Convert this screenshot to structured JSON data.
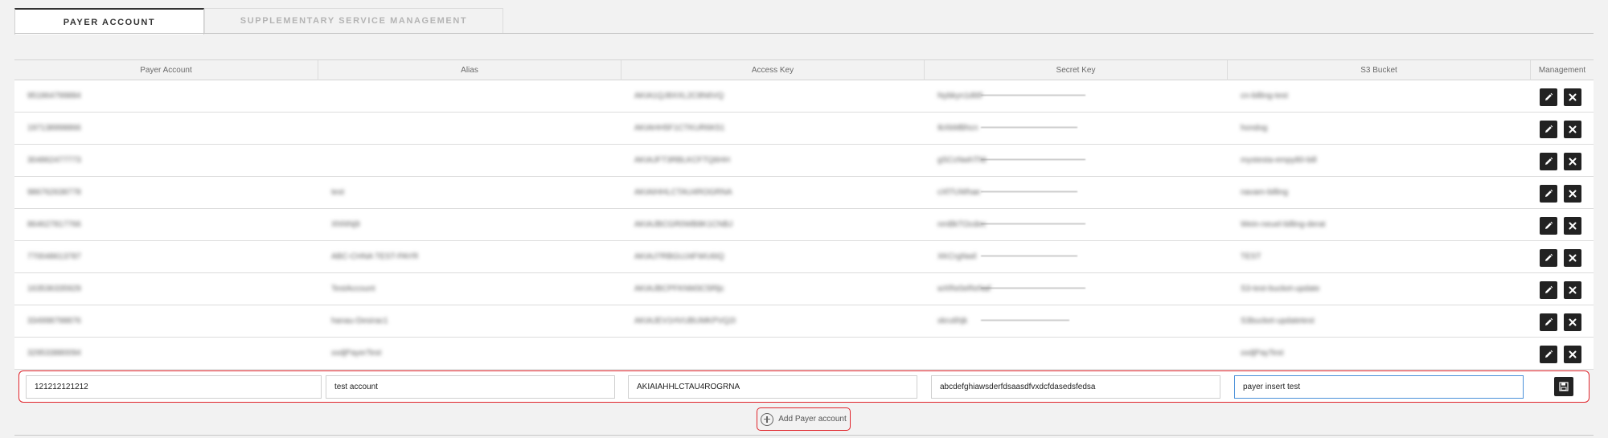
{
  "tabs": [
    {
      "label": "PAYER ACCOUNT",
      "active": true
    },
    {
      "label": "SUPPLEMENTARY SERVICE MANAGEMENT",
      "active": false
    }
  ],
  "table": {
    "headers": [
      "Payer Account",
      "Alias",
      "Access Key",
      "Secret Key",
      "S3 Bucket",
      "Management"
    ],
    "rows": [
      {
        "payer": "951864799884",
        "alias": "",
        "access_key": "AKIA1QJ8XXL2C8N6VQ",
        "secret_key": "Nybkyn1d6tf",
        "bucket": "cn-billing-test"
      },
      {
        "payer": "197138998866",
        "alias": "",
        "access_key": "AKIAHH5F1CTKUR6K51",
        "secret_key": "IkXkMBhcn",
        "bucket": "hondog"
      },
      {
        "payer": "304862477773",
        "alias": "",
        "access_key": "AKIAJFT3RBLKCFTQ6HH",
        "secret_key": "gSCcNwhTNt",
        "bucket": "mystesta-empy80-bill"
      },
      {
        "payer": "986762638778",
        "alias": "test",
        "access_key": "AKIAIHHLCTAU4ROGRNA",
        "secret_key": "cXf7UWhae",
        "bucket": "navam-billing"
      },
      {
        "payer": "864627817766",
        "alias": "Xhf4Nj9",
        "access_key": "AKIAJBCGR0WB8K1CNBJ",
        "secret_key": "nmBkTOcdec",
        "bucket": "Wein-neuel-billing-derat"
      },
      {
        "payer": "770048613787",
        "alias": "ABC-CHNA TEST-PAYR",
        "access_key": "AKIAJ7RBGUJ4FWU6IQ",
        "secret_key": "XKCrgNwil",
        "bucket": "TEST"
      },
      {
        "payer": "163536335929",
        "alias": "TestAccount",
        "access_key": "AKIAJBCPFKNM3C5Rljc",
        "secret_key": "wXRe0eReNaf",
        "bucket": "S3-test-bucket-update"
      },
      {
        "payer": "334998798876",
        "alias": "hanau-Desirac1",
        "access_key": "AKIAJEV1HVUBUMKPVQ2I",
        "secret_key": "xkru6hjk",
        "bucket": "S3bucket-updatetest"
      },
      {
        "payer": "329533880094",
        "alias": "xxdjPayerTest",
        "access_key": "",
        "secret_key": "",
        "bucket": "xxdjPayTest"
      }
    ]
  },
  "insert_row": {
    "payer": "121212121212",
    "alias": "test account",
    "access_key": "AKIAIAHHLCTAU4ROGRNA",
    "secret_key": "abcdefghiawsderfdsaasdfvxdcfdasedsfedsa",
    "bucket": "payer insert test"
  },
  "add_button": {
    "label": "Add Payer account"
  },
  "icons": {
    "edit": "pencil-icon",
    "delete": "close-icon",
    "save": "floppy-icon",
    "add": "plus-circle-icon"
  },
  "colors": {
    "highlight": "#e0242b",
    "button": "#222222",
    "focus": "#4a90d9"
  }
}
